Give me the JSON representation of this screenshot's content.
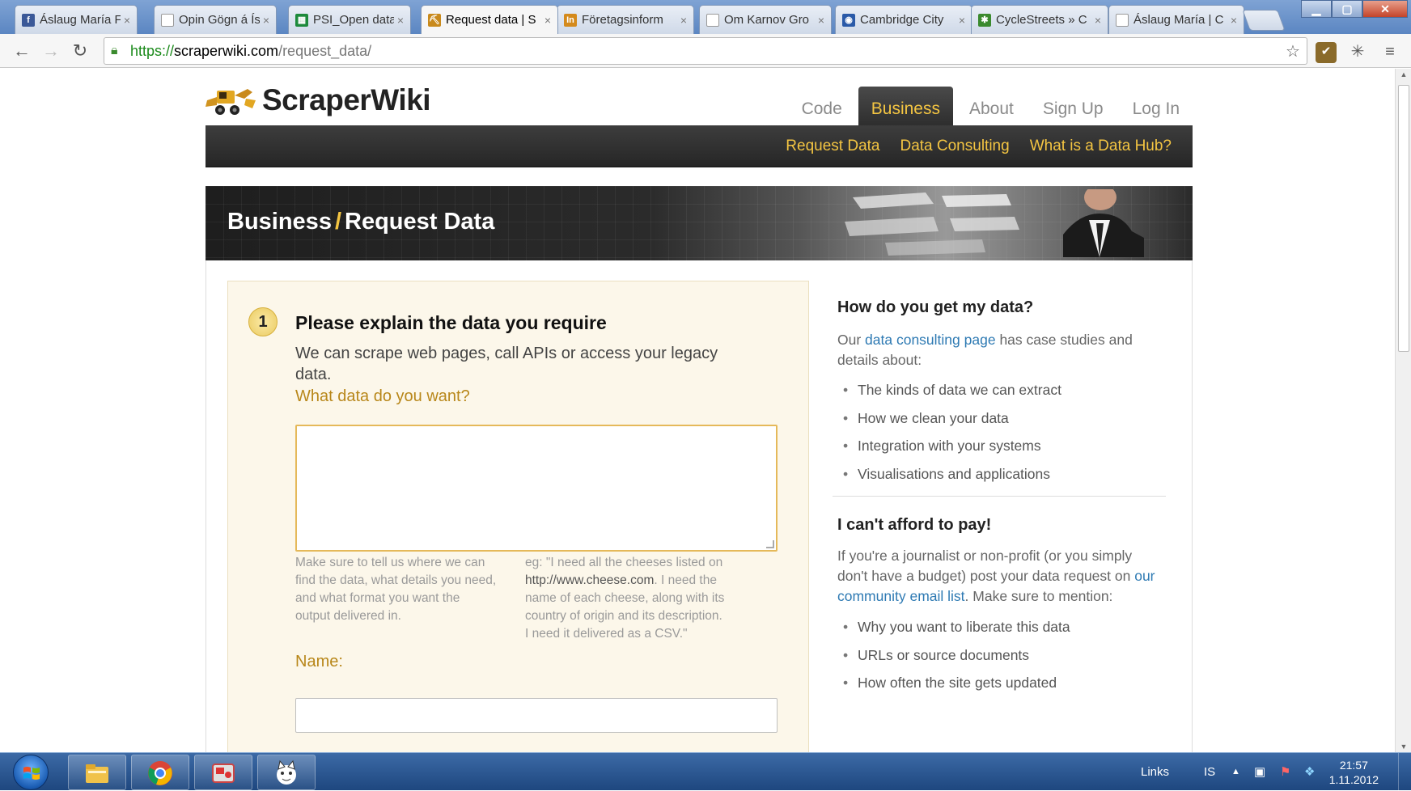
{
  "browser": {
    "tabs": [
      {
        "label": "Áslaug María Fr",
        "favicon": "facebook-icon",
        "favicon_color": "#3b5998",
        "favicon_text": "f"
      },
      {
        "label": "Opin Gögn á Ísl",
        "favicon": "page-icon",
        "favicon_color": "#ffffff",
        "favicon_text": ""
      },
      {
        "label": "PSI_Open data i",
        "favicon": "spreadsheet-icon",
        "favicon_color": "#1d8a3b",
        "favicon_text": "▦"
      },
      {
        "label": "Request data | S",
        "favicon": "scraperwiki-icon",
        "favicon_color": "#c98a1c",
        "favicon_text": "⛏"
      },
      {
        "label": "Företagsinform",
        "favicon": "infotorg-icon",
        "favicon_color": "#d48a1c",
        "favicon_text": "In"
      },
      {
        "label": "Om Karnov Gro",
        "favicon": "page-icon",
        "favicon_color": "#ffffff",
        "favicon_text": ""
      },
      {
        "label": "Cambridge City",
        "favicon": "globe-icon",
        "favicon_color": "#2a5aa8",
        "favicon_text": "◉"
      },
      {
        "label": "CycleStreets » C",
        "favicon": "cyclestreets-icon",
        "favicon_color": "#3b8a2e",
        "favicon_text": "✱"
      },
      {
        "label": "Áslaug María | C",
        "favicon": "page-icon",
        "favicon_color": "#ffffff",
        "favicon_text": ""
      }
    ],
    "active_tab": 3,
    "url_scheme": "https://",
    "url_host": "scraperwiki.com",
    "url_path": "/request_data/",
    "window_controls": {
      "minimize": "▁",
      "maximize": "▢",
      "close": "✕"
    }
  },
  "site": {
    "logo_text": "ScraperWiki",
    "nav": [
      {
        "label": "Code",
        "active": false
      },
      {
        "label": "Business",
        "active": true
      },
      {
        "label": "About",
        "active": false
      },
      {
        "label": "Sign Up",
        "active": false
      },
      {
        "label": "Log In",
        "active": false
      }
    ],
    "subnav": [
      "Request Data",
      "Data Consulting",
      "What is a Data Hub?"
    ],
    "banner": {
      "section": "Business",
      "separator": "/",
      "page": "Request Data"
    },
    "accent_color": "#f4c542",
    "link_color": "#2e7ab3"
  },
  "form": {
    "step_number": "1",
    "step_title": "Please explain the data you require",
    "step_description": "We can scrape web pages, call APIs or access your legacy data.",
    "data_label": "What data do you want?",
    "data_value": "",
    "hint_left": "Make sure to tell us where we can find the data, what details you need, and what format you want the output delivered in.",
    "hint_right_prefix": "eg: \"I need all the cheeses listed on ",
    "hint_right_url": "http://www.cheese.com",
    "hint_right_suffix": ". I need the name of each cheese, along with its country of origin and its description. I need it delivered as a CSV.\"",
    "name_label": "Name:",
    "name_value": ""
  },
  "sidebar": {
    "section1_title": "How do you get my data?",
    "section1_text_prefix": "Our ",
    "section1_link": "data consulting page",
    "section1_text_suffix": " has case studies and details about:",
    "section1_items": [
      "The kinds of data we can extract",
      "How we clean your data",
      "Integration with your systems",
      "Visualisations and applications"
    ],
    "section2_title": "I can't afford to pay!",
    "section2_text_prefix": "If you're a journalist or non-profit (or you simply don't have a budget) post your data request on ",
    "section2_link": "our community email list",
    "section2_text_suffix": ". Make sure to mention:",
    "section2_items": [
      "Why you want to liberate this data",
      "URLs or source documents",
      "How often the site gets updated"
    ]
  },
  "taskbar": {
    "pinned": [
      "explorer-icon",
      "chrome-icon",
      "media-app-icon",
      "cat-app-icon"
    ],
    "links_label": "Links",
    "language": "IS",
    "time": "21:57",
    "date": "1.11.2012"
  }
}
